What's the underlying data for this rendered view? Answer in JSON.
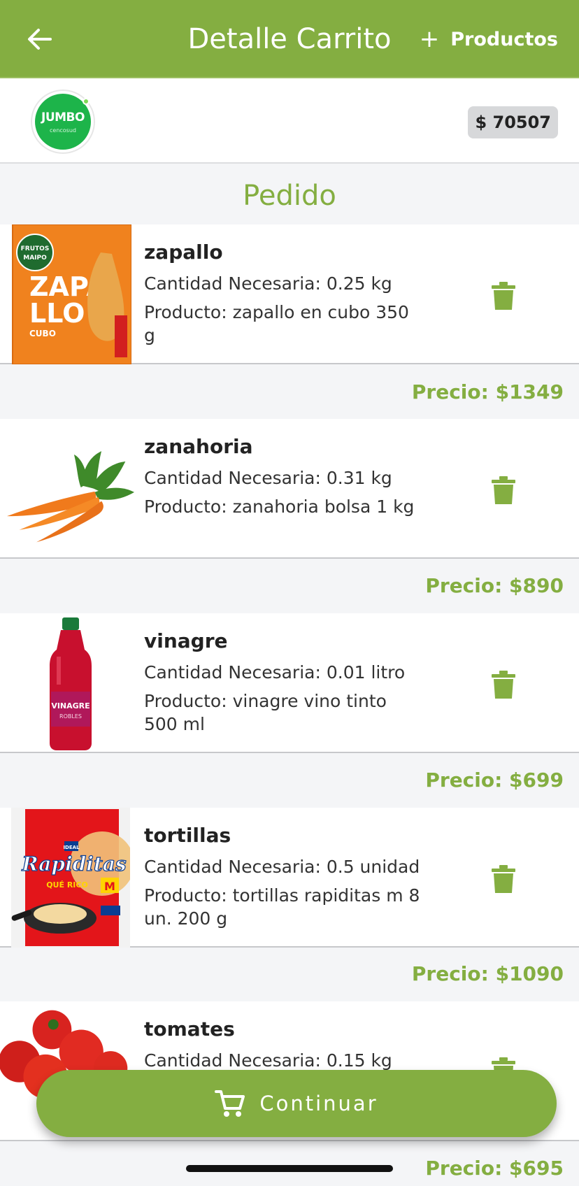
{
  "header": {
    "title": "Detalle Carrito",
    "add_products_label": "Productos",
    "background": "#84ae41"
  },
  "store": {
    "logo_text": "JUMBO",
    "logo_sub": "cencosud",
    "total": "$ 70507"
  },
  "section_title": "Pedido",
  "items": [
    {
      "name": "zapallo",
      "quantity": "Cantidad Necesaria: 0.25 kg",
      "product": "Producto: zapallo en cubo 350 g",
      "price": "Precio: $1349",
      "image": "zapallo-package"
    },
    {
      "name": "zanahoria",
      "quantity": "Cantidad Necesaria: 0.31 kg",
      "product": "Producto: zanahoria bolsa 1 kg",
      "price": "Precio: $890",
      "image": "carrots"
    },
    {
      "name": "vinagre",
      "quantity": "Cantidad Necesaria: 0.01 litro",
      "product": "Producto: vinagre vino tinto 500 ml",
      "price": "Precio: $699",
      "image": "vinegar-bottle"
    },
    {
      "name": "tortillas",
      "quantity": "Cantidad Necesaria: 0.5 unidad",
      "product": "Producto: tortillas rapiditas m 8 un. 200 g",
      "price": "Precio: $1090",
      "image": "tortillas-package"
    },
    {
      "name": "tomates",
      "quantity": "Cantidad Necesaria: 0.15 kg",
      "product": "",
      "price": "Precio: $695",
      "image": "tomatoes"
    }
  ],
  "continue_label": "Continuar",
  "colors": {
    "accent": "#84ae41",
    "delete": "#84ae41",
    "background": "#f4f5f7"
  }
}
